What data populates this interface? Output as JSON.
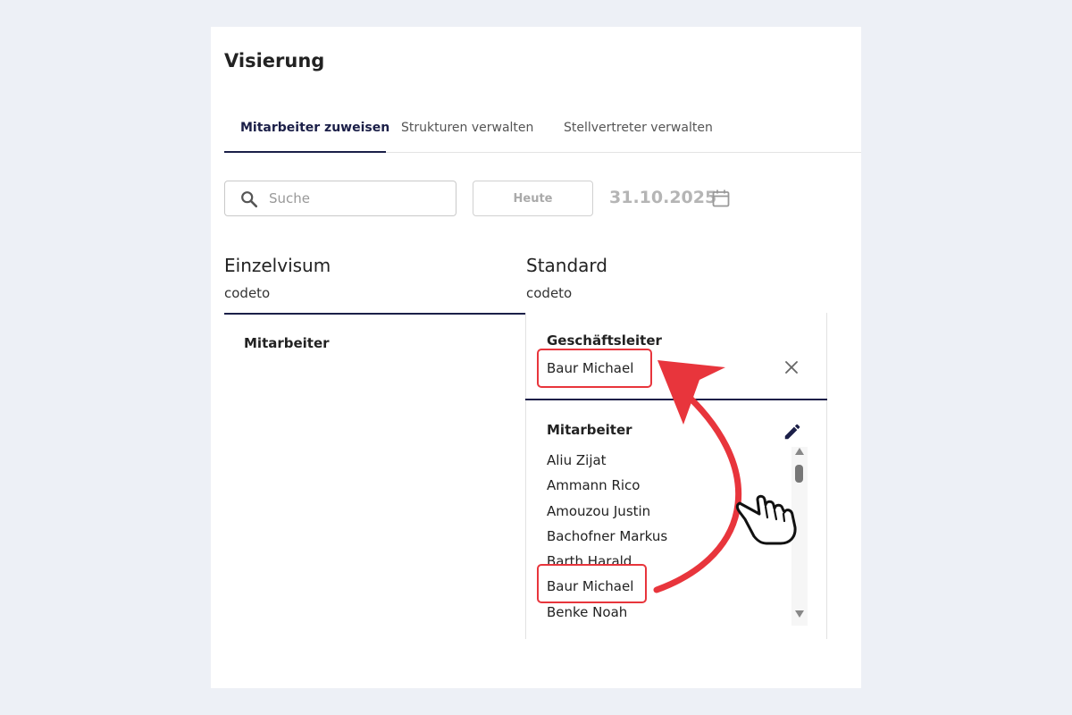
{
  "page": {
    "title": "Visierung"
  },
  "tabs": [
    {
      "label": "Mitarbeiter zuweisen",
      "active": true
    },
    {
      "label": "Strukturen verwalten",
      "active": false
    },
    {
      "label": "Stellvertreter verwalten",
      "active": false
    }
  ],
  "toolbar": {
    "search_placeholder": "Suche",
    "search_value": "",
    "today_label": "Heute",
    "date": "31.10.2025"
  },
  "left_column": {
    "title": "Einzelvisum",
    "subtitle": "codeto",
    "section_label": "Mitarbeiter"
  },
  "right_column": {
    "title": "Standard",
    "subtitle": "codeto",
    "manager_label": "Geschäftsleiter",
    "manager_name": "Baur Michael",
    "employees_label": "Mitarbeiter",
    "employees": [
      "Aliu Zijat",
      "Ammann Rico",
      "Amouzou Justin",
      "Bachofner Markus",
      "Barth Harald",
      "Baur Michael",
      "Benke Noah"
    ]
  },
  "icons": {
    "search": "search-icon",
    "calendar": "calendar-icon",
    "close": "close-icon",
    "edit": "pencil-icon",
    "pointer": "hand-pointer-icon"
  },
  "colors": {
    "accent": "#1b1f48",
    "highlight": "#e8353c",
    "background": "#edf0f6"
  }
}
